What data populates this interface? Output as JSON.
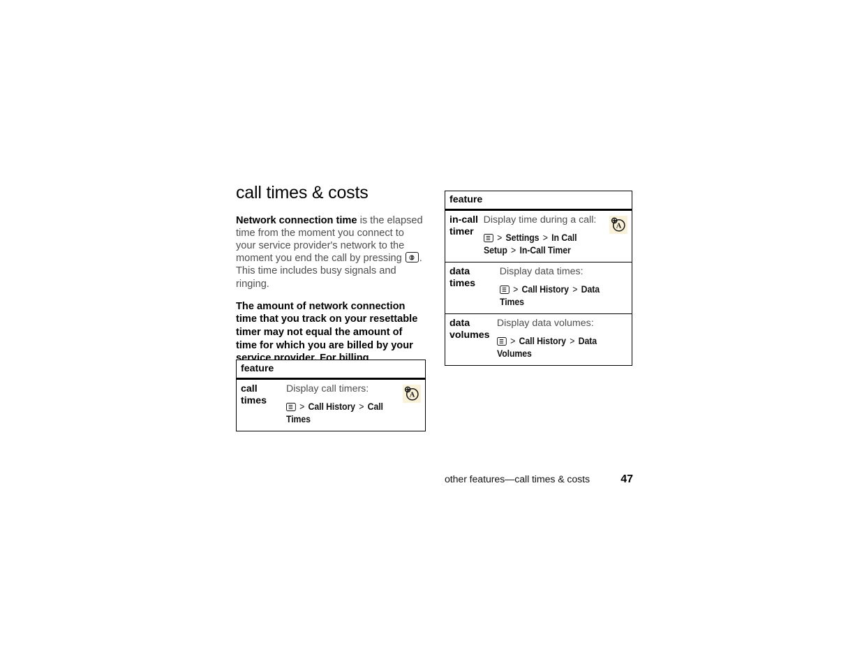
{
  "page": {
    "section_title": "call times & costs",
    "footer_text": "other features—call times & costs",
    "page_number": "47"
  },
  "intro": {
    "p1_bold": "Network connection time",
    "p1_part_a": " is the elapsed time from the moment you connect to your service provider's network to the moment you end the call by pressing ",
    "p1_part_b": ". This time includes busy signals and ringing.",
    "p2": "The amount of network connection time that you track on your resettable timer may not equal the amount of time for which you are billed by your service provider. For billing information, contact your service provider."
  },
  "icons": {
    "end_call_key": "end-call-key-icon",
    "menu_key": "menu-key-icon",
    "network_badge": "network-a-badge-icon"
  },
  "left_table": {
    "header": "feature",
    "rows": [
      {
        "name": "call times",
        "lead": "Display call timers:",
        "path_1": "Call History",
        "path_2": "Call Times",
        "sep": ">",
        "has_badge": true
      }
    ]
  },
  "right_table": {
    "header": "feature",
    "rows": [
      {
        "name_line1": "in-call",
        "name_line2": "timer",
        "lead": "Display time during a call:",
        "path_1": "Settings",
        "path_2": "In Call Setup",
        "path_3": "In-Call Timer",
        "sep": ">",
        "has_badge": true
      },
      {
        "name_line1": "data times",
        "name_line2": "",
        "lead": "Display data times:",
        "path_1": "Call History",
        "path_2": "Data Times",
        "sep": ">",
        "has_badge": false
      },
      {
        "name_line1": "data",
        "name_line2": "volumes",
        "lead": "Display data volumes:",
        "path_1": "Call History",
        "path_2": "Data Volumes",
        "sep": ">",
        "has_badge": false
      }
    ]
  },
  "colors": {
    "badge_background": "#faf2d8",
    "body_text": "#4d4d4d",
    "heading_text": "#000000",
    "rule": "#000000"
  }
}
